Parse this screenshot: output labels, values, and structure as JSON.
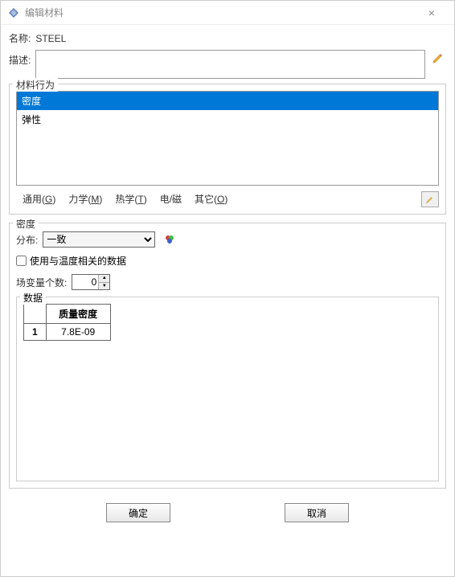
{
  "window": {
    "title": "编辑材料",
    "close": "×"
  },
  "name": {
    "label": "名称:",
    "value": "STEEL"
  },
  "description": {
    "label": "描述:",
    "value": ""
  },
  "behavior": {
    "legend": "材料行为",
    "items": [
      {
        "label": "密度",
        "selected": true
      },
      {
        "label": "弹性",
        "selected": false
      }
    ],
    "menus": {
      "general": "通用(G)",
      "mechanical": "力学(M)",
      "thermal": "热学(T)",
      "electrical": "电/磁",
      "other": "其它(O)"
    }
  },
  "density": {
    "legend": "密度",
    "distribution": {
      "label": "分布:",
      "value": "一致"
    },
    "temp_dependent": {
      "label": "使用与温度相关的数据",
      "checked": false
    },
    "field_vars": {
      "label": "场变量个数:",
      "value": "0"
    },
    "data": {
      "legend": "数据",
      "header": "质量密度",
      "rows": [
        {
          "idx": "1",
          "value": "7.8E-09"
        }
      ]
    }
  },
  "buttons": {
    "ok": "确定",
    "cancel": "取消"
  }
}
